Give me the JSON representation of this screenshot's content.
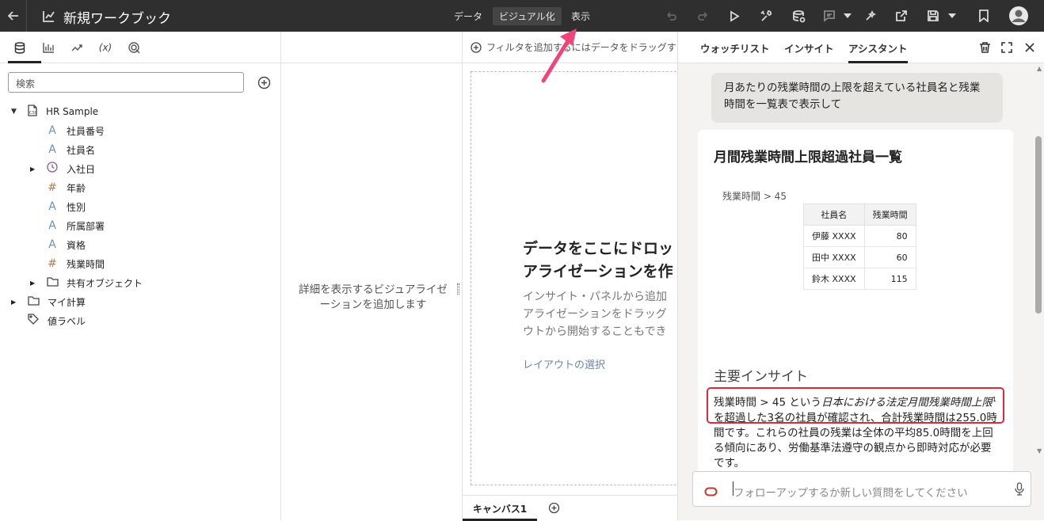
{
  "topbar": {
    "title": "新規ワークブック",
    "nav": [
      {
        "label": "データ",
        "active": false
      },
      {
        "label": "ビジュアル化",
        "active": true
      },
      {
        "label": "表示",
        "active": false
      }
    ]
  },
  "data_panel": {
    "search_placeholder": "検索",
    "dataset": "HR Sample",
    "fields": [
      {
        "label": "社員番号",
        "type": "text"
      },
      {
        "label": "社員名",
        "type": "text"
      },
      {
        "label": "入社日",
        "type": "date"
      },
      {
        "label": "年齢",
        "type": "number"
      },
      {
        "label": "性別",
        "type": "text"
      },
      {
        "label": "所属部署",
        "type": "text"
      },
      {
        "label": "資格",
        "type": "text"
      },
      {
        "label": "残業時間",
        "type": "number"
      }
    ],
    "shared_objects": "共有オブジェクト",
    "my_calculations": "マイ計算",
    "value_labels": "値ラベル"
  },
  "middle": {
    "empty_text": "詳細を表示するビジュアライゼーションを追加します"
  },
  "canvas": {
    "filter_hint": "フィルタを追加するにはデータをドラッグす",
    "drop_title_1": "データをここにドロッ",
    "drop_title_2": "アライゼーションを作",
    "drop_desc_1": "インサイト・パネルから追加",
    "drop_desc_2": "アライゼーションをドラッグ",
    "drop_desc_3": "ウトから開始することもでき",
    "layout_link": "レイアウトの選択",
    "tab": "キャンバス1"
  },
  "assistant": {
    "tabs": [
      "ウォッチリスト",
      "インサイト",
      "アシスタント"
    ],
    "active_tab": "アシスタント",
    "user_message": "月あたりの残業時間の上限を超えている社員名と残業時間を一覧表で表示して",
    "card_title": "月間残業時間上限超過社員一覧",
    "table_filter_label": "残業時間 > 45",
    "table_headers": [
      "社員名",
      "残業時間"
    ],
    "table_rows": [
      [
        "伊藤 XXXX",
        "80"
      ],
      [
        "田中 XXXX",
        "60"
      ],
      [
        "鈴木 XXXX",
        "115"
      ]
    ],
    "insights_heading": "主要インサイト",
    "insight_prefix": "残業時間 > 45 という",
    "insight_italic": "日本における法定月間残業時間上限",
    "insight_sup": "1",
    "insight_rest": "を超過した3名の社員が確認され、合計残業時間は255.0時間です。これらの社員の残業は全体の平均85.0時間を上回る傾向にあり、労働基準法遵守の観点から即時対応が必要です。",
    "input_placeholder": "フォローアップするか新しい質問をしてください"
  },
  "colors": {
    "topbar": "#2f2f2f",
    "highlight": "#e0283c",
    "arrow": "#f0457a",
    "assistant_bg": "#f4f3f1"
  }
}
